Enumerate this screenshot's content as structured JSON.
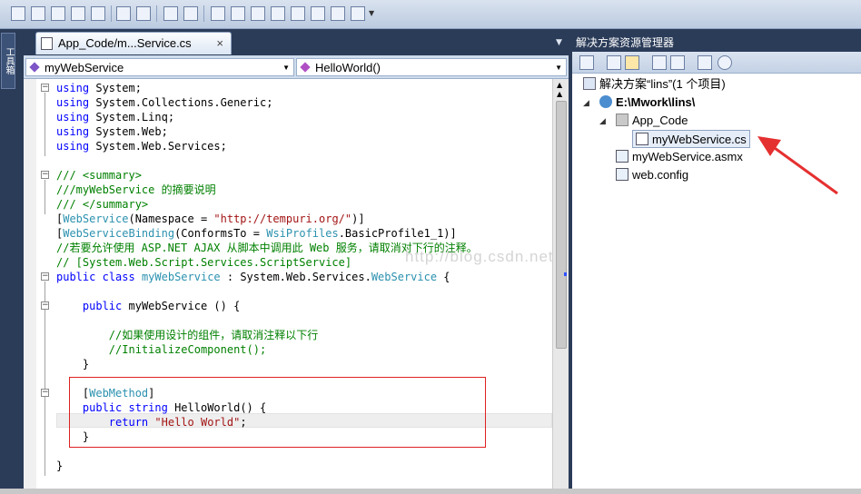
{
  "left_tab": {
    "label": "工具箱"
  },
  "editor": {
    "tab_title": "App_Code/m...Service.cs",
    "tab_close": "×",
    "class_dropdown": "myWebService",
    "member_dropdown": "HelloWorld()",
    "watermark": "http://blog.csdn.net/",
    "code_lines": [
      "using System;",
      "using System.Collections.Generic;",
      "using System.Linq;",
      "using System.Web;",
      "using System.Web.Services;",
      "",
      "/// <summary>",
      "///myWebService 的摘要说明",
      "/// </summary>",
      "[WebService(Namespace = \"http://tempuri.org/\")]",
      "[WebServiceBinding(ConformsTo = WsiProfiles.BasicProfile1_1)]",
      "//若要允许使用 ASP.NET AJAX 从脚本中调用此 Web 服务，请取消对下行的注释。",
      "// [System.Web.Script.Services.ScriptService]",
      "public class myWebService : System.Web.Services.WebService {",
      "",
      "    public myWebService () {",
      "",
      "        //如果使用设计的组件，请取消注释以下行",
      "        //InitializeComponent();",
      "    }",
      "",
      "    [WebMethod]",
      "    public string HelloWorld() {",
      "        return \"Hello World\";",
      "    }",
      "",
      "}"
    ]
  },
  "solution_explorer": {
    "title": "解决方案资源管理器",
    "solution_label": "解决方案“lins”(1 个项目)",
    "project_label": "E:\\Mwork\\lins\\",
    "app_code_label": "App_Code",
    "selected_file": "myWebService.cs",
    "asmx_file": "myWebService.asmx",
    "config_file": "web.config"
  },
  "colors": {
    "keyword": "#0000ff",
    "comment": "#008000",
    "type": "#2b91af",
    "string": "#a31515",
    "annotation_box": "#e02020",
    "arrow": "#e53030",
    "frame": "#2b3c59"
  }
}
